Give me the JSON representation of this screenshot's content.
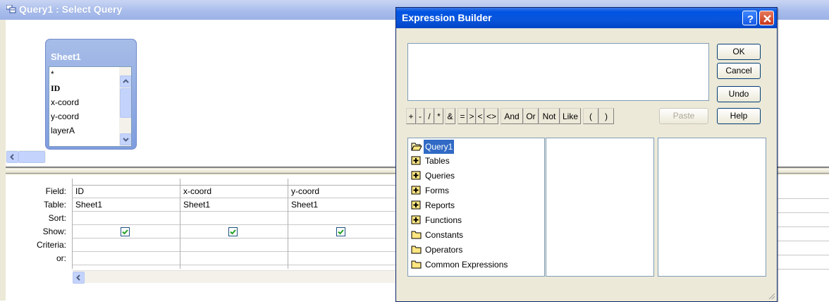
{
  "query_window": {
    "title": "Query1 : Select Query",
    "table_box": {
      "title": "Sheet1",
      "fields": [
        "*",
        "ID",
        "x-coord",
        "y-coord",
        "layerA"
      ]
    },
    "grid": {
      "row_labels": [
        "Field:",
        "Table:",
        "Sort:",
        "Show:",
        "Criteria:",
        "or:"
      ],
      "columns": [
        {
          "field": "ID",
          "table": "Sheet1",
          "sort": "",
          "show": true,
          "criteria": "",
          "or": ""
        },
        {
          "field": "x-coord",
          "table": "Sheet1",
          "sort": "",
          "show": true,
          "criteria": "",
          "or": ""
        },
        {
          "field": "y-coord",
          "table": "Sheet1",
          "sort": "",
          "show": true,
          "criteria": "",
          "or": ""
        }
      ]
    }
  },
  "dialog": {
    "title": "Expression Builder",
    "expression_value": "",
    "buttons": {
      "ok": "OK",
      "cancel": "Cancel",
      "undo": "Undo",
      "help": "Help",
      "paste": "Paste"
    },
    "operators": [
      "+",
      "-",
      "/",
      "*",
      "&",
      "=",
      ">",
      "<",
      "<>",
      "And",
      "Or",
      "Not",
      "Like",
      "(",
      ")"
    ],
    "folder_tree": [
      {
        "label": "Query1",
        "icon": "open-folder-icon",
        "selected": true
      },
      {
        "label": "Tables",
        "icon": "expand-folder-icon"
      },
      {
        "label": "Queries",
        "icon": "expand-folder-icon"
      },
      {
        "label": "Forms",
        "icon": "expand-folder-icon"
      },
      {
        "label": "Reports",
        "icon": "expand-folder-icon"
      },
      {
        "label": "Functions",
        "icon": "expand-folder-icon"
      },
      {
        "label": "Constants",
        "icon": "folder-icon"
      },
      {
        "label": "Operators",
        "icon": "folder-icon"
      },
      {
        "label": "Common Expressions",
        "icon": "folder-icon"
      }
    ]
  },
  "colors": {
    "selection": "#316ac5",
    "title_bar": "#0054e3",
    "window_bg": "#ece9d8"
  }
}
